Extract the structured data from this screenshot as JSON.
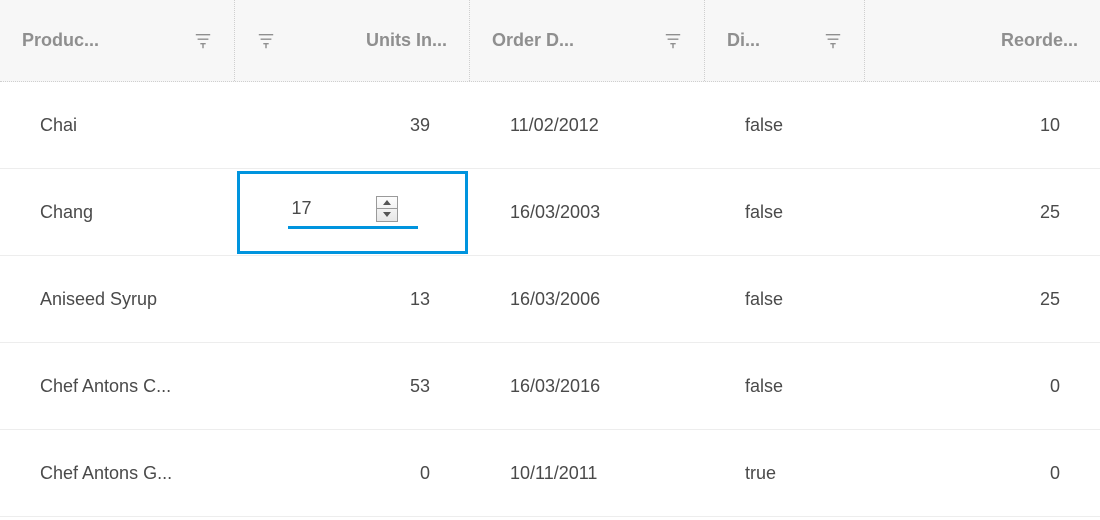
{
  "columns": {
    "product": "Produc...",
    "units": "Units In...",
    "orderDate": "Order D...",
    "discontinued": "Di...",
    "reorder": "Reorde..."
  },
  "editing": {
    "rowIndex": 1,
    "column": "units",
    "value": "17"
  },
  "rows": [
    {
      "product": "Chai",
      "units": "39",
      "orderDate": "11/02/2012",
      "discontinued": "false",
      "reorder": "10"
    },
    {
      "product": "Chang",
      "units": "17",
      "orderDate": "16/03/2003",
      "discontinued": "false",
      "reorder": "25"
    },
    {
      "product": "Aniseed Syrup",
      "units": "13",
      "orderDate": "16/03/2006",
      "discontinued": "false",
      "reorder": "25"
    },
    {
      "product": "Chef Antons C...",
      "units": "53",
      "orderDate": "16/03/2016",
      "discontinued": "false",
      "reorder": "0"
    },
    {
      "product": "Chef Antons G...",
      "units": "0",
      "orderDate": "10/11/2011",
      "discontinued": "true",
      "reorder": "0"
    }
  ]
}
